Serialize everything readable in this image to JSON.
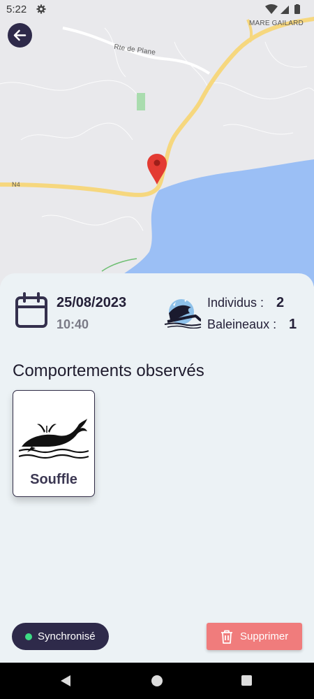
{
  "status_bar": {
    "time": "5:22",
    "icons": [
      "gear-icon",
      "wifi-icon",
      "signal-icon",
      "battery-icon"
    ]
  },
  "map": {
    "labels": {
      "place": "MARE GAILARD",
      "road": "Rte de Plane",
      "highway": "N4"
    },
    "colors": {
      "water": "#9bbff5",
      "road": "#f6d77e",
      "land": "#e9e9ec",
      "marker": "#e33b33"
    }
  },
  "observation": {
    "date": "25/08/2023",
    "time": "10:40",
    "individus_label": "Individus :",
    "individus_value": "2",
    "baleineaux_label": "Baleineaux :",
    "baleineaux_value": "1"
  },
  "behaviors": {
    "title": "Comportements observés",
    "items": [
      {
        "label": "Souffle",
        "icon": "whale-blow-icon"
      }
    ]
  },
  "footer": {
    "sync_label": "Synchronisé",
    "sync_color": "#3ddc84",
    "delete_label": "Supprimer",
    "delete_color": "#f07c7c"
  }
}
